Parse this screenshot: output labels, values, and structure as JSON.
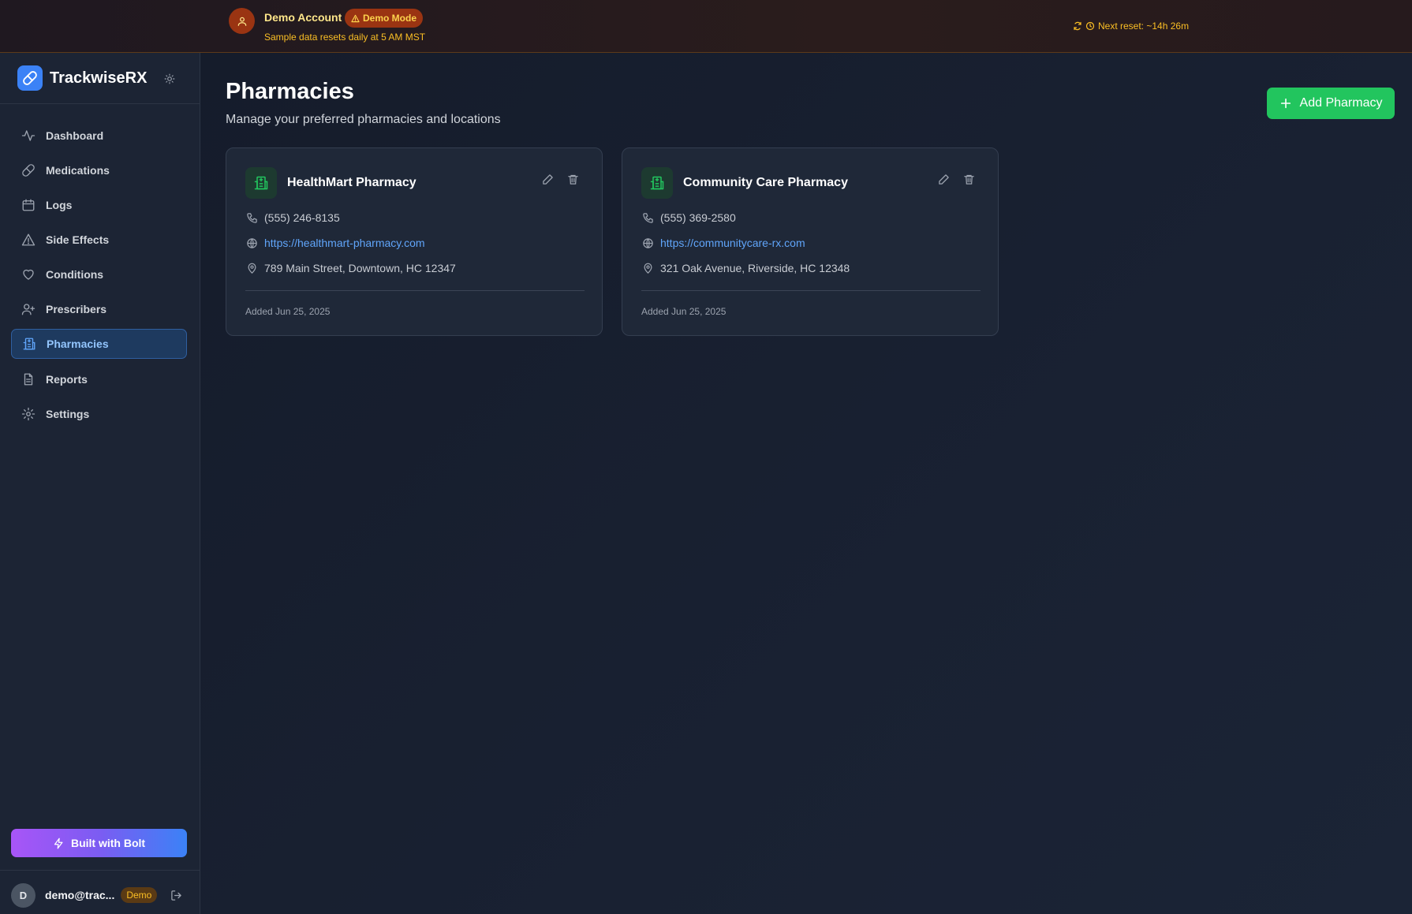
{
  "banner": {
    "title": "Demo Account",
    "mode_label": "Demo Mode",
    "subtitle": "Sample data resets daily at 5 AM MST",
    "reset_label": "Next reset: ~14h 26m"
  },
  "brand": {
    "name": "TrackwiseRX"
  },
  "sidebar": {
    "items": [
      {
        "label": "Dashboard",
        "icon": "activity-icon"
      },
      {
        "label": "Medications",
        "icon": "pill-icon"
      },
      {
        "label": "Logs",
        "icon": "calendar-icon"
      },
      {
        "label": "Side Effects",
        "icon": "warning-icon"
      },
      {
        "label": "Conditions",
        "icon": "heart-icon"
      },
      {
        "label": "Prescribers",
        "icon": "user-plus-icon"
      },
      {
        "label": "Pharmacies",
        "icon": "building-icon",
        "active": true
      },
      {
        "label": "Reports",
        "icon": "document-icon"
      },
      {
        "label": "Settings",
        "icon": "gear-icon"
      }
    ],
    "bolt_label": "Built with Bolt"
  },
  "user": {
    "initial": "D",
    "email": "demo@trac...",
    "badge": "Demo"
  },
  "page": {
    "title": "Pharmacies",
    "subtitle": "Manage your preferred pharmacies and locations",
    "add_label": "Add Pharmacy"
  },
  "pharmacies": [
    {
      "name": "HealthMart Pharmacy",
      "phone": "(555) 246-8135",
      "website": "https://healthmart-pharmacy.com",
      "address": "789 Main Street, Downtown, HC 12347",
      "added": "Added Jun 25, 2025"
    },
    {
      "name": "Community Care Pharmacy",
      "phone": "(555) 369-2580",
      "website": "https://communitycare-rx.com",
      "address": "321 Oak Avenue, Riverside, HC 12348",
      "added": "Added Jun 25, 2025"
    }
  ],
  "colors": {
    "accent_blue": "#3b82f6",
    "success_green": "#22c55e",
    "demo_amber": "#fbbf24",
    "background": "#141b29"
  }
}
